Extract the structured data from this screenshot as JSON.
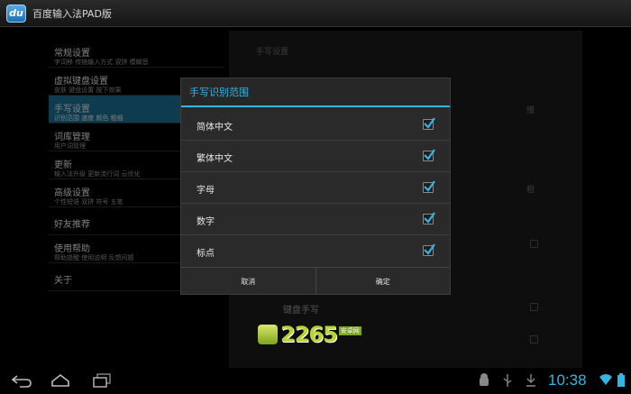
{
  "app": {
    "title": "百度输入法PAD版",
    "icon_text": "du"
  },
  "left_list": [
    {
      "title": "常规设置",
      "subtitle": "字词移    传统输入方式    双拼    模糊音",
      "selected": false
    },
    {
      "title": "虚拟键盘设置",
      "subtitle": "皮肤    键盘设置    按下效果",
      "selected": false
    },
    {
      "title": "手写设置",
      "subtitle": "识别范围    速度    颜色    粗细",
      "selected": true
    },
    {
      "title": "词库管理",
      "subtitle": "用户词管理",
      "selected": false
    },
    {
      "title": "更新",
      "subtitle": "输入法升级    更新流行词    云优化",
      "selected": false
    },
    {
      "title": "高级设置",
      "subtitle": "个性短语    双拼    符号    五笔",
      "selected": false
    },
    {
      "title": "好友推荐",
      "subtitle": "",
      "selected": false
    },
    {
      "title": "使用帮助",
      "subtitle": "帮助提醒    使用说明    反馈问题",
      "selected": false
    },
    {
      "title": "关于",
      "subtitle": "",
      "selected": false
    }
  ],
  "right_panel": {
    "header": "手写设置",
    "speed_value": "慢",
    "thickness_value": "粗",
    "keyboard_handwriting": "键盘手写"
  },
  "dialog": {
    "title": "手写识别范围",
    "options": [
      {
        "label": "简体中文",
        "checked": true
      },
      {
        "label": "繁体中文",
        "checked": true
      },
      {
        "label": "字母",
        "checked": true
      },
      {
        "label": "数字",
        "checked": true
      },
      {
        "label": "标点",
        "checked": true
      }
    ],
    "cancel_label": "取消",
    "ok_label": "确定"
  },
  "watermark": {
    "text": "2265",
    "sub": "安卓网"
  },
  "status": {
    "time": "10:38"
  },
  "colors": {
    "accent": "#33b5e5",
    "selected_row": "#1a6e8e"
  }
}
